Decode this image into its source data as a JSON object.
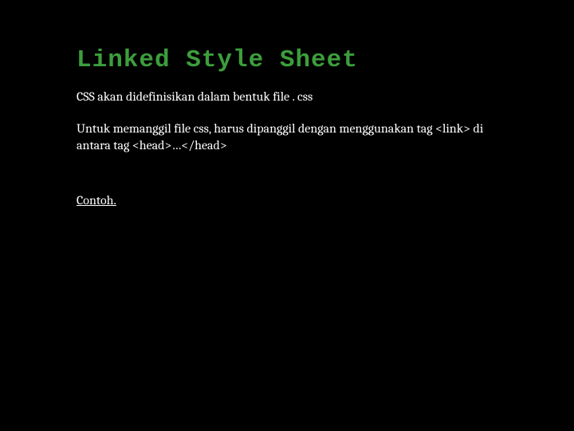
{
  "title": "Linked Style Sheet",
  "paragraphs": {
    "p1": "CSS akan didefinisikan dalam bentuk file . css",
    "p2": "Untuk memanggil file css, harus dipanggil dengan menggunakan tag <link> di antara tag <head>…</head>"
  },
  "link_label": "Contoh."
}
